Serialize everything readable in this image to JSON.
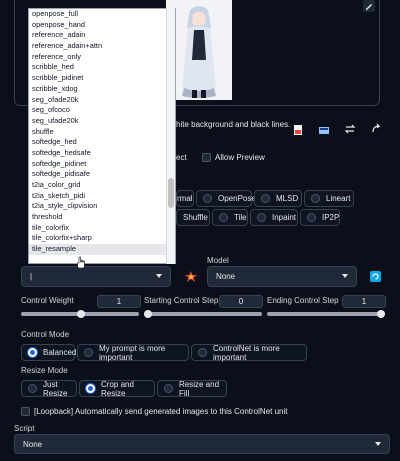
{
  "image_panel": {
    "hint_text": "hite background and black lines."
  },
  "options": {
    "select_label": "ect",
    "allow_preview": "Allow Preview"
  },
  "control_types": {
    "row1": [
      "rmal",
      "OpenPose",
      "MLSD",
      "Lineart"
    ],
    "row2": [
      "Shuffle",
      "Tile",
      "Inpaint",
      "IP2P"
    ]
  },
  "preprocessor": {
    "value": "|"
  },
  "model": {
    "label": "Model",
    "value": "None"
  },
  "control_weight": {
    "label": "Control Weight",
    "value": "1",
    "fraction": 0.5
  },
  "start_step": {
    "label": "Starting Control Step",
    "value": "0",
    "fraction": 0.0
  },
  "end_step": {
    "label": "Ending Control Step",
    "value": "1",
    "fraction": 1.0
  },
  "control_mode": {
    "label": "Control Mode",
    "options": [
      "Balanced",
      "My prompt is more important",
      "ControlNet is more important"
    ],
    "selected": 0
  },
  "resize_mode": {
    "label": "Resize Mode",
    "options": [
      "Just Resize",
      "Crop and Resize",
      "Resize and Fill"
    ],
    "selected": 1
  },
  "loopback": {
    "label": "[Loopback] Automatically send generated images to this ControlNet unit"
  },
  "script": {
    "label": "Script",
    "value": "None"
  },
  "dropdown_items": [
    "openpose_full",
    "openpose_hand",
    "reference_adain",
    "reference_adain+attn",
    "reference_only",
    "scribble_hed",
    "scribble_pidinet",
    "scribble_xdog",
    "seg_ofade20k",
    "seg_ofcoco",
    "seg_ufade20k",
    "shuffle",
    "softedge_hed",
    "softedge_hedsafe",
    "softedge_pidinet",
    "softedge_pidisafe",
    "t2ia_color_grid",
    "t2ia_sketch_pidi",
    "t2ia_style_clipvision",
    "threshold",
    "tile_colorfix",
    "tile_colorfix+sharp",
    "tile_resample"
  ],
  "icons": {
    "edit": "pencil-icon",
    "doc": "document-icon",
    "camera": "camera-icon",
    "swap": "swap-arrows-icon",
    "rotate": "rotate-icon",
    "explode": "explosion-icon",
    "refresh": "refresh-icon"
  },
  "colors": {
    "background": "#0b0f19",
    "accent": "#2563eb",
    "orange": "#f97316"
  }
}
